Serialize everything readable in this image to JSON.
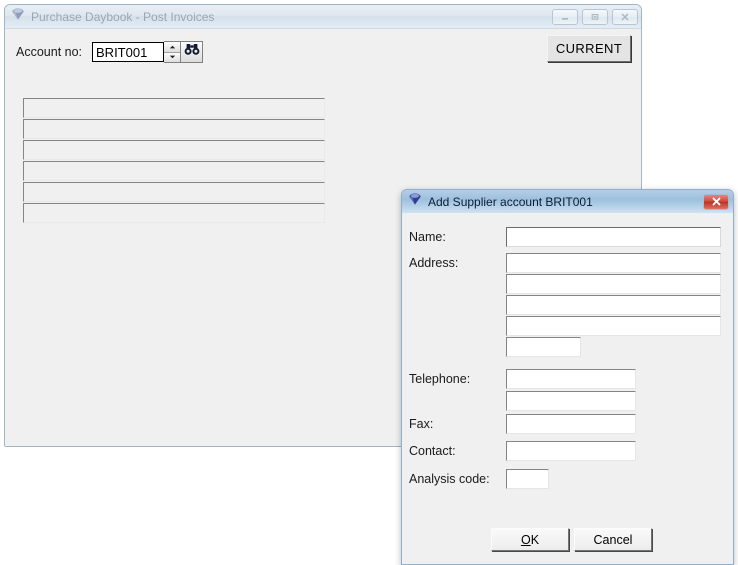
{
  "main_window": {
    "icon": "gem-icon",
    "title": "Purchase Daybook - Post Invoices",
    "active": false,
    "controls": {
      "minimize_label": "Minimize",
      "restore_label": "Restore",
      "close_label": "Close"
    },
    "account": {
      "label": "Account no:",
      "value": "BRIT001",
      "placeholder": "",
      "spinner_up": "▲",
      "spinner_down": "▼",
      "find_icon": "binoculars-icon"
    },
    "current_button_label": "CURRENT",
    "grid_rows": [
      "",
      "",
      "",
      "",
      "",
      ""
    ]
  },
  "dialog": {
    "icon": "gem-icon",
    "title": "Add Supplier account BRIT001",
    "active": true,
    "close_label": "Close",
    "fields": [
      {
        "label": "Name:",
        "value": "",
        "placeholder": "",
        "width": "wide",
        "focused": true
      },
      {
        "label": "Address:",
        "value": "",
        "placeholder": "",
        "width": "wide",
        "focused": false
      },
      {
        "label": "",
        "value": "",
        "placeholder": "",
        "width": "wide",
        "focused": false
      },
      {
        "label": "",
        "value": "",
        "placeholder": "",
        "width": "wide",
        "focused": false
      },
      {
        "label": "",
        "value": "",
        "placeholder": "",
        "width": "wide",
        "focused": false
      },
      {
        "label": "",
        "value": "",
        "placeholder": "",
        "width": "short",
        "focused": false
      },
      {
        "label": "Telephone:",
        "value": "",
        "placeholder": "",
        "width": "mid",
        "focused": false
      },
      {
        "label": "",
        "value": "",
        "placeholder": "",
        "width": "mid",
        "focused": false
      },
      {
        "label": "Fax:",
        "value": "",
        "placeholder": "",
        "width": "mid",
        "focused": false
      },
      {
        "label": "Contact:",
        "value": "",
        "placeholder": "",
        "width": "mid",
        "focused": false
      },
      {
        "label": "Analysis code:",
        "value": "",
        "placeholder": "",
        "width": "tiny",
        "focused": false
      }
    ],
    "ok_label": "OK",
    "ok_accel": "O",
    "cancel_label": "Cancel"
  },
  "colors": {
    "window_face": "#f0f0f0",
    "title_active_blue": "#9dc0de",
    "title_inactive": "#dfe8f0",
    "close_red": "#cf4a3c",
    "icon_blue": "#3b4f9e"
  }
}
